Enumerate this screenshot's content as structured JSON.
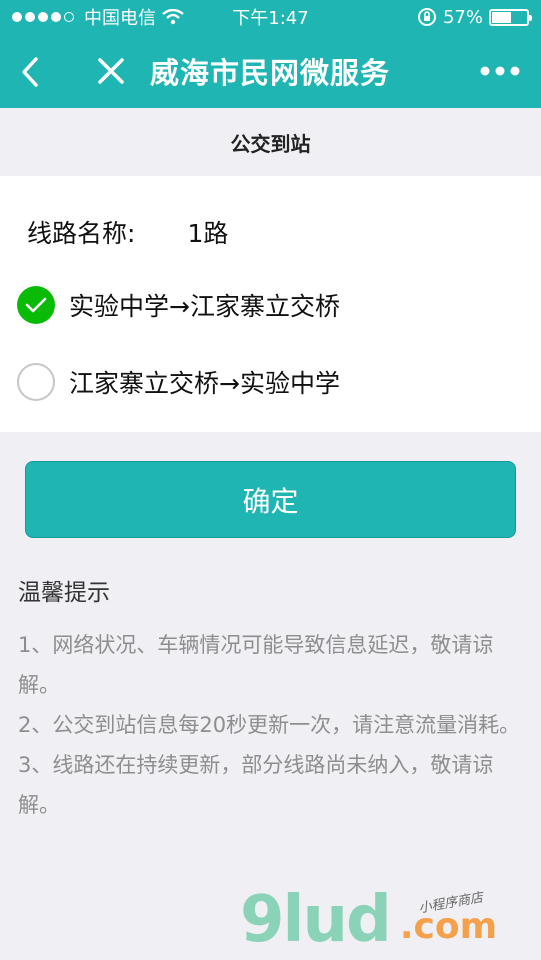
{
  "status_bar": {
    "carrier": "中国电信",
    "time": "下午1:47",
    "battery_percent": "57%",
    "battery_level": 0.57,
    "signal_bars": 4
  },
  "nav": {
    "title": "威海市民网微服务",
    "back_icon": "chevron-left-icon",
    "close_icon": "close-icon",
    "more_icon": "more-dots-icon"
  },
  "page": {
    "subtitle": "公交到站"
  },
  "route": {
    "label": "线路名称:",
    "value": "1路",
    "directions": [
      {
        "label": "实验中学→江家寨立交桥",
        "selected": true
      },
      {
        "label": "江家寨立交桥→实验中学",
        "selected": false
      }
    ]
  },
  "confirm_label": "确定",
  "tips": {
    "title": "温馨提示",
    "items": [
      "1、网络状况、车辆情况可能导致信息延迟，敬请谅解。",
      "2、公交到站信息每20秒更新一次，请注意流量消耗。",
      "3、线路还在持续更新，部分线路尚未纳入，敬请谅解。"
    ]
  },
  "watermark": {
    "main": "9lud",
    "suffix": ".com",
    "tag": "小程序商店"
  },
  "colors": {
    "primary": "#1fb5b3",
    "check": "#09bb07",
    "background": "#efeff4"
  }
}
